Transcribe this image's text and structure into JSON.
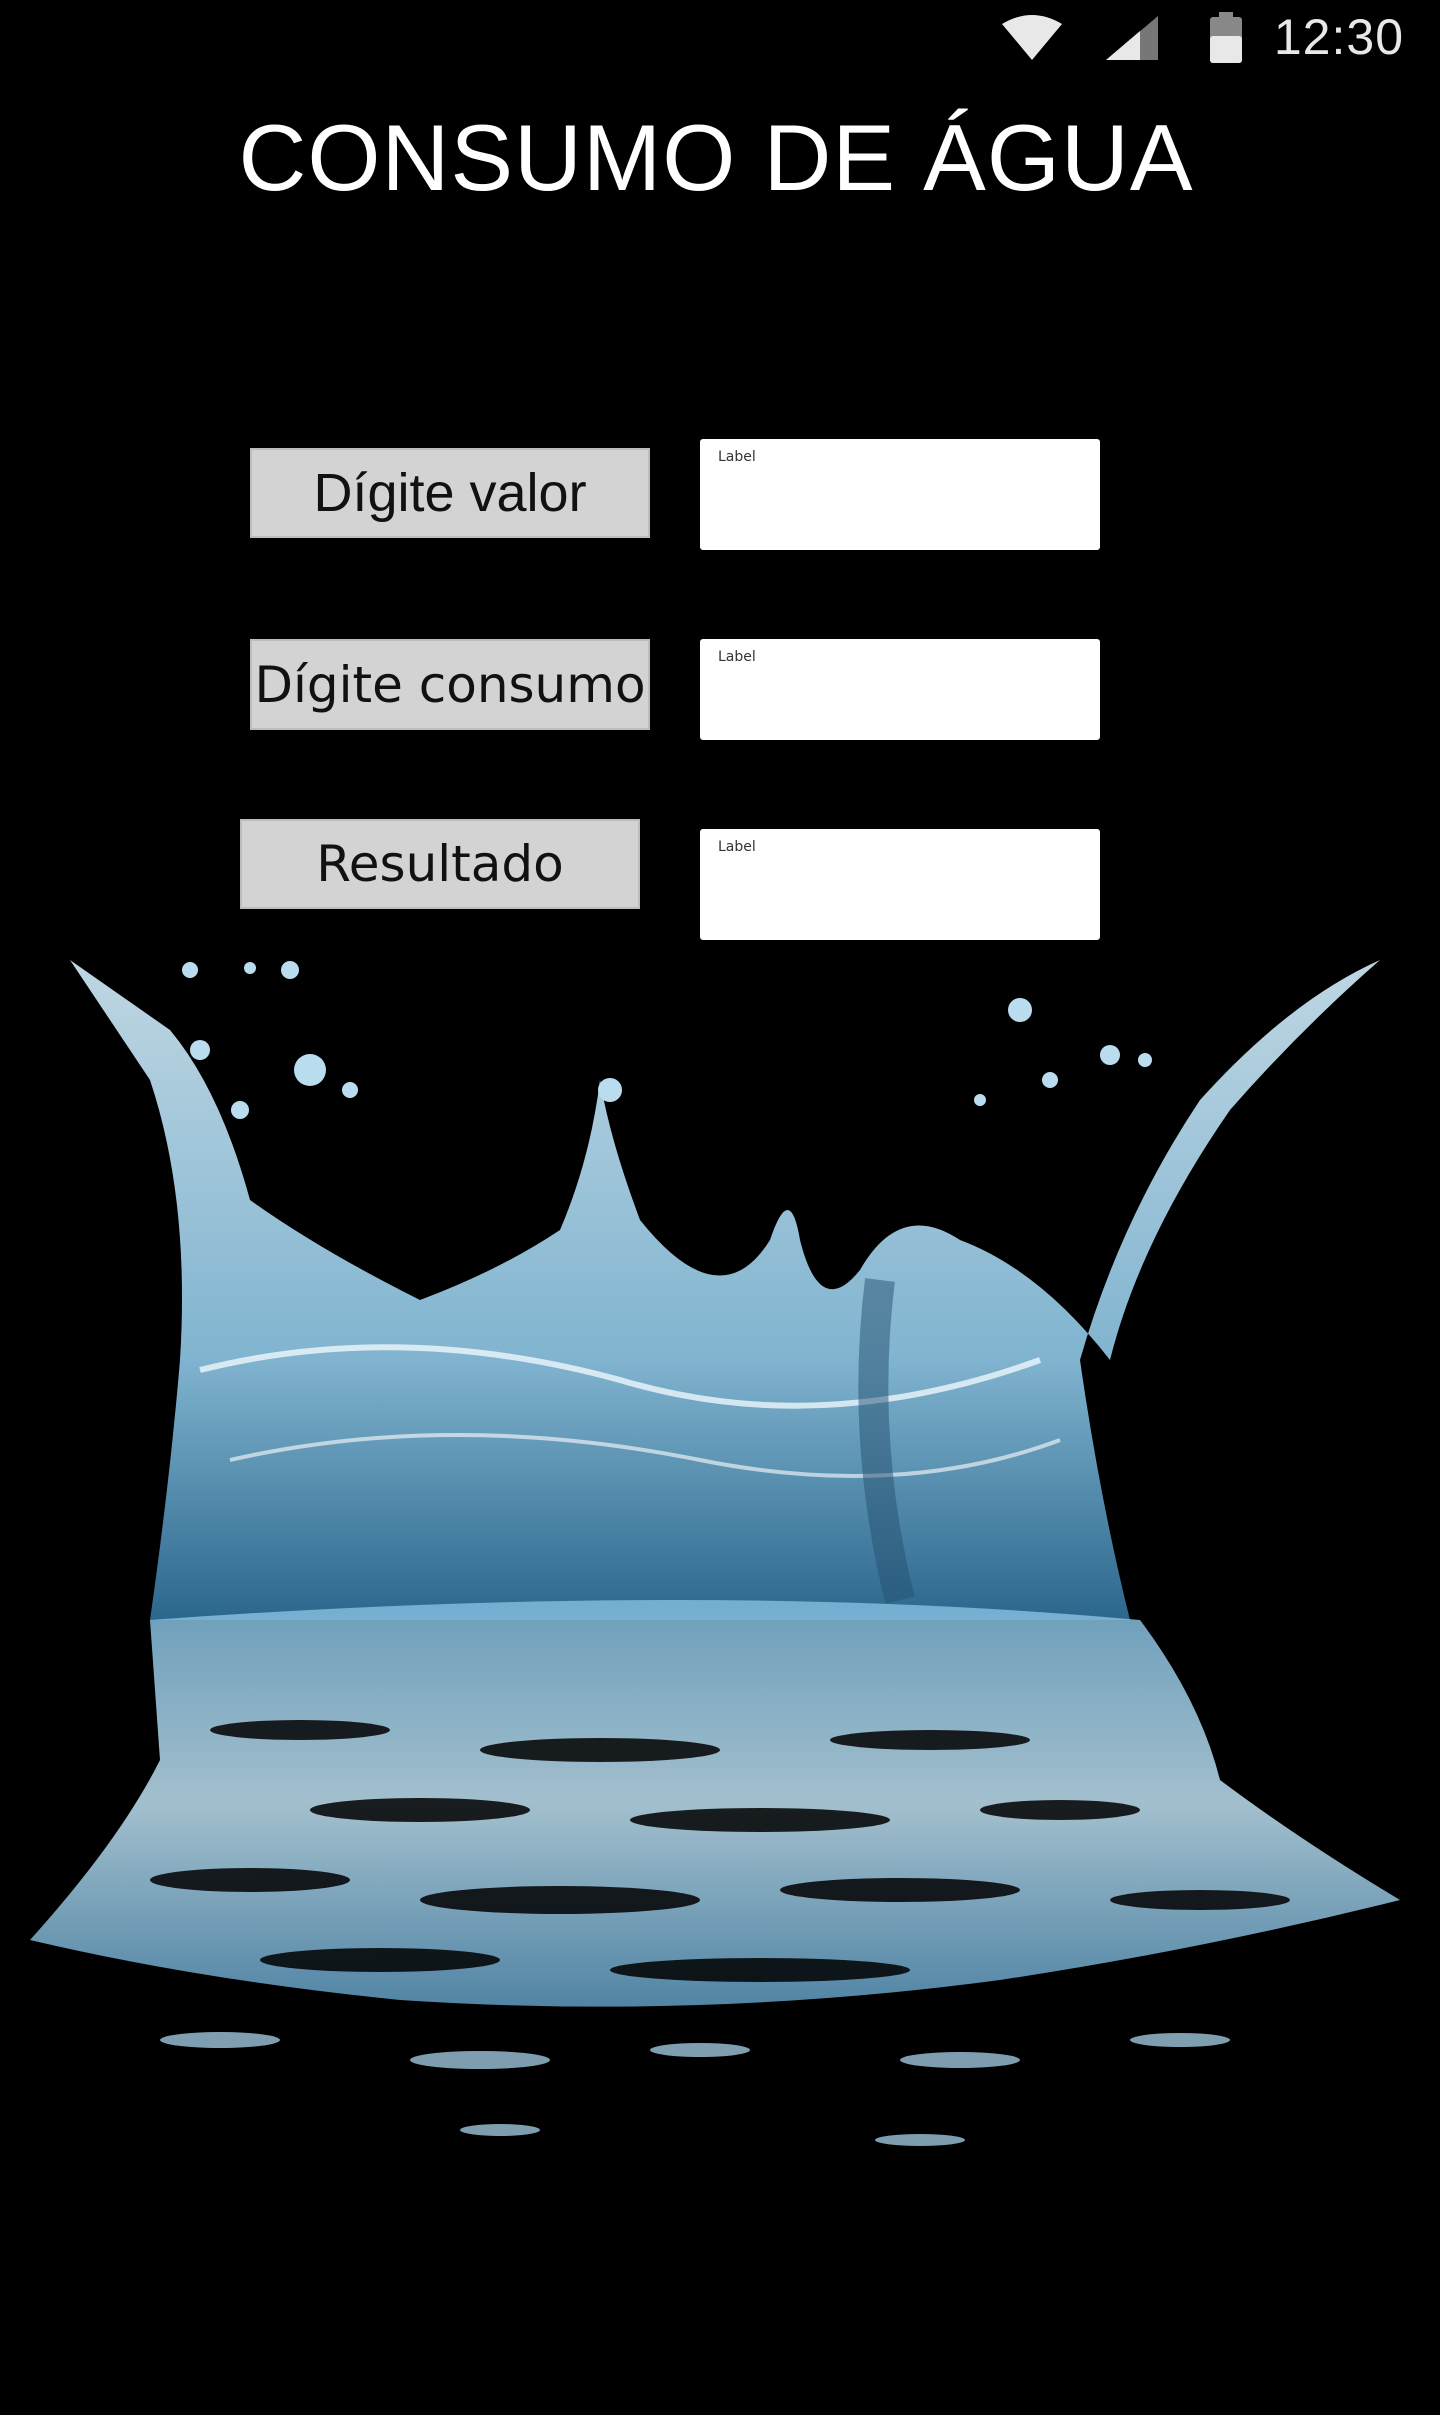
{
  "status_bar": {
    "time": "12:30",
    "icons": [
      "wifi-icon",
      "signal-icon",
      "battery-icon"
    ]
  },
  "title": "CONSUMO DE ÁGUA",
  "form": {
    "rows": [
      {
        "button_label": "Dígite valor",
        "field_label": "Label"
      },
      {
        "button_label": "Dígite consumo",
        "field_label": "Label"
      },
      {
        "button_label": "Resultado",
        "field_label": "Label"
      }
    ]
  },
  "colors": {
    "background": "#000000",
    "button_bg": "#d3d3d3",
    "field_bg": "#ffffff",
    "water": "#9fd0ea"
  }
}
